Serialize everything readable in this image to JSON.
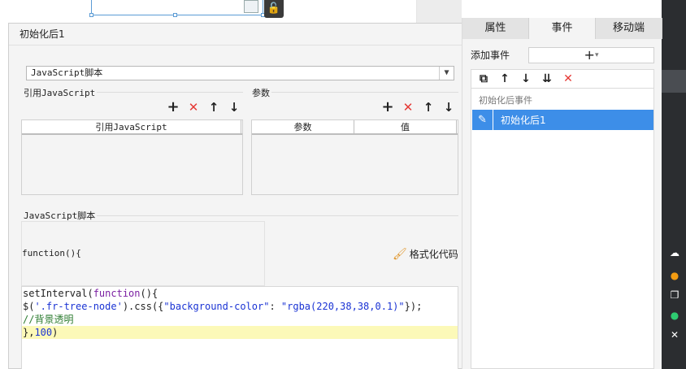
{
  "dialog": {
    "title": "初始化后1",
    "script_type": "JavaScript脚本",
    "ref_section_label": "引用JavaScript",
    "params_section_label": "参数",
    "ref_table": {
      "columns": [
        "引用JavaScript"
      ]
    },
    "params_table": {
      "columns": [
        "参数",
        "值"
      ]
    },
    "script_section_label": "JavaScript脚本",
    "function_header": "function(){",
    "format_button": "格式化代码",
    "code_lines": [
      "setInterval(function(){",
      "$('.fr-tree-node').css({\"background-color\": \"rgba(220,38,38,0.1)\"});",
      "//背景透明",
      "},100)"
    ]
  },
  "right_panel": {
    "tabs": [
      "属性",
      "事件",
      "移动端"
    ],
    "active_tab": "事件",
    "add_event_label": "添加事件",
    "event_group_header": "初始化后事件",
    "selected_event": "初始化后1"
  },
  "icons": {
    "add": "plus-icon",
    "delete": "x-icon",
    "up": "arrow-up-icon",
    "down": "arrow-down-icon",
    "copy": "copy-icon",
    "edit": "pencil-icon",
    "format": "brush-icon",
    "lock": "lock-icon"
  },
  "colors": {
    "accent": "#3d8ee8",
    "delete_red": "#e53935",
    "keyword": "#7b1fa2",
    "string": "#1a33d4",
    "comment": "#2e7d32",
    "current_line": "#fcf9b8"
  }
}
